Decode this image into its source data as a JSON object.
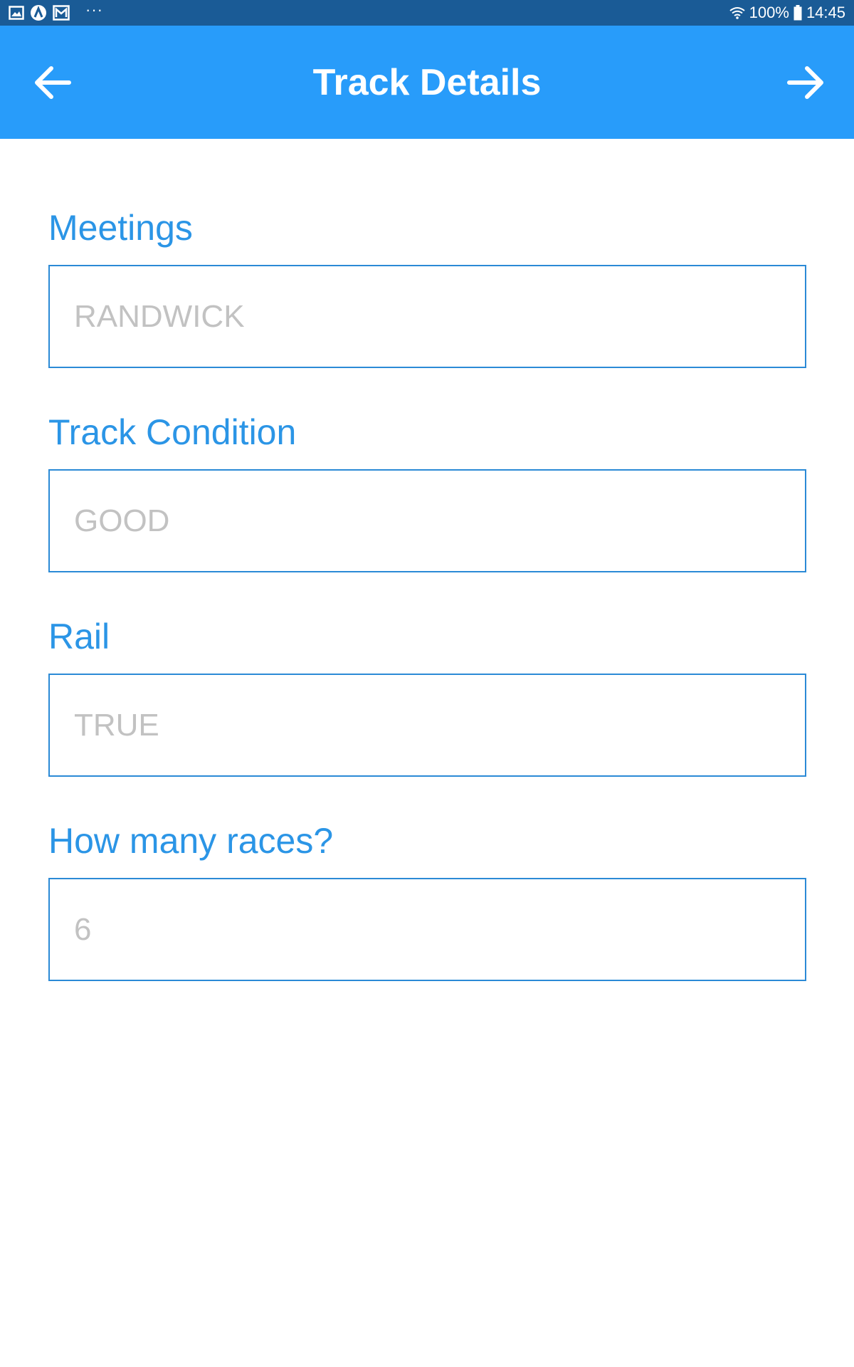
{
  "status_bar": {
    "battery": "100%",
    "time": "14:45",
    "overflow": "···"
  },
  "app_bar": {
    "title": "Track Details",
    "back_icon": "arrow-left-icon",
    "forward_icon": "arrow-right-icon",
    "color": "#289cfa"
  },
  "form": {
    "fields": [
      {
        "label": "Meetings",
        "placeholder": "RANDWICK"
      },
      {
        "label": "Track Condition",
        "placeholder": "GOOD"
      },
      {
        "label": "Rail",
        "placeholder": "TRUE"
      },
      {
        "label": "How many races?",
        "placeholder": "6"
      }
    ]
  }
}
